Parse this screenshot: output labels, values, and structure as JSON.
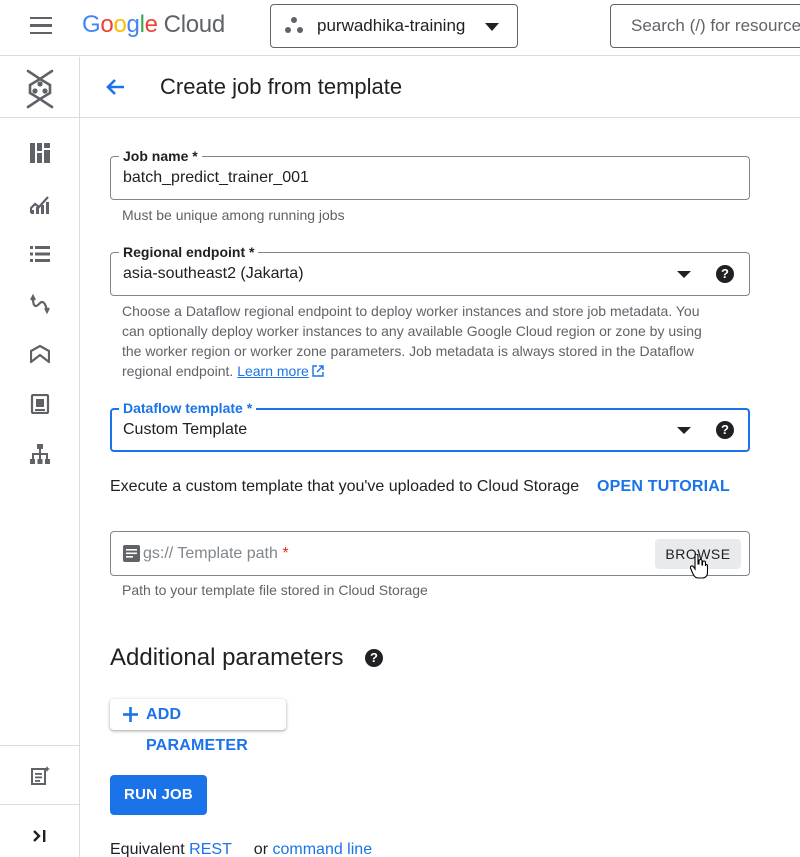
{
  "topbar": {
    "logo_letters": [
      "G",
      "o",
      "o",
      "g",
      "l",
      "e"
    ],
    "logo_suffix": "Cloud",
    "project_name": "purwadhika-training",
    "search_placeholder": "Search (/) for resources"
  },
  "header": {
    "title": "Create job from template"
  },
  "form": {
    "job_name": {
      "label": "Job name *",
      "value": "batch_predict_trainer_001",
      "hint": "Must be unique among running jobs"
    },
    "regional_endpoint": {
      "label": "Regional endpoint *",
      "value": "asia-southeast2 (Jakarta)",
      "help": "?",
      "hint": "Choose a Dataflow regional endpoint to deploy worker instances and store job metadata. You can optionally deploy worker instances to any available Google Cloud region or zone by using the worker region or worker zone parameters. Job metadata is always stored in the Dataflow regional endpoint.",
      "hint_link": "Learn more"
    },
    "dataflow_template": {
      "label": "Dataflow template *",
      "value": "Custom Template",
      "help": "?"
    },
    "template_description": "Execute a custom template that you've uploaded to Cloud Storage",
    "tutorial_label": "OPEN TUTORIAL",
    "template_path": {
      "placeholder": "gs://  Template path",
      "required_mark": "*",
      "browse_label": "BROWSE",
      "hint": "Path to your template file stored in Cloud Storage"
    }
  },
  "additional": {
    "title": "Additional parameters",
    "help": "?",
    "add_label": "ADD PARAMETER"
  },
  "actions": {
    "run_label": "RUN JOB",
    "equivalent_prefix": "Equivalent",
    "rest_label": "REST",
    "or_label": "or",
    "cli_label": "command line"
  },
  "colors": {
    "accent": "#1a73e8",
    "text": "#202124",
    "secondary_text": "#5f6368",
    "border": "#80868b",
    "required": "#d93025"
  }
}
